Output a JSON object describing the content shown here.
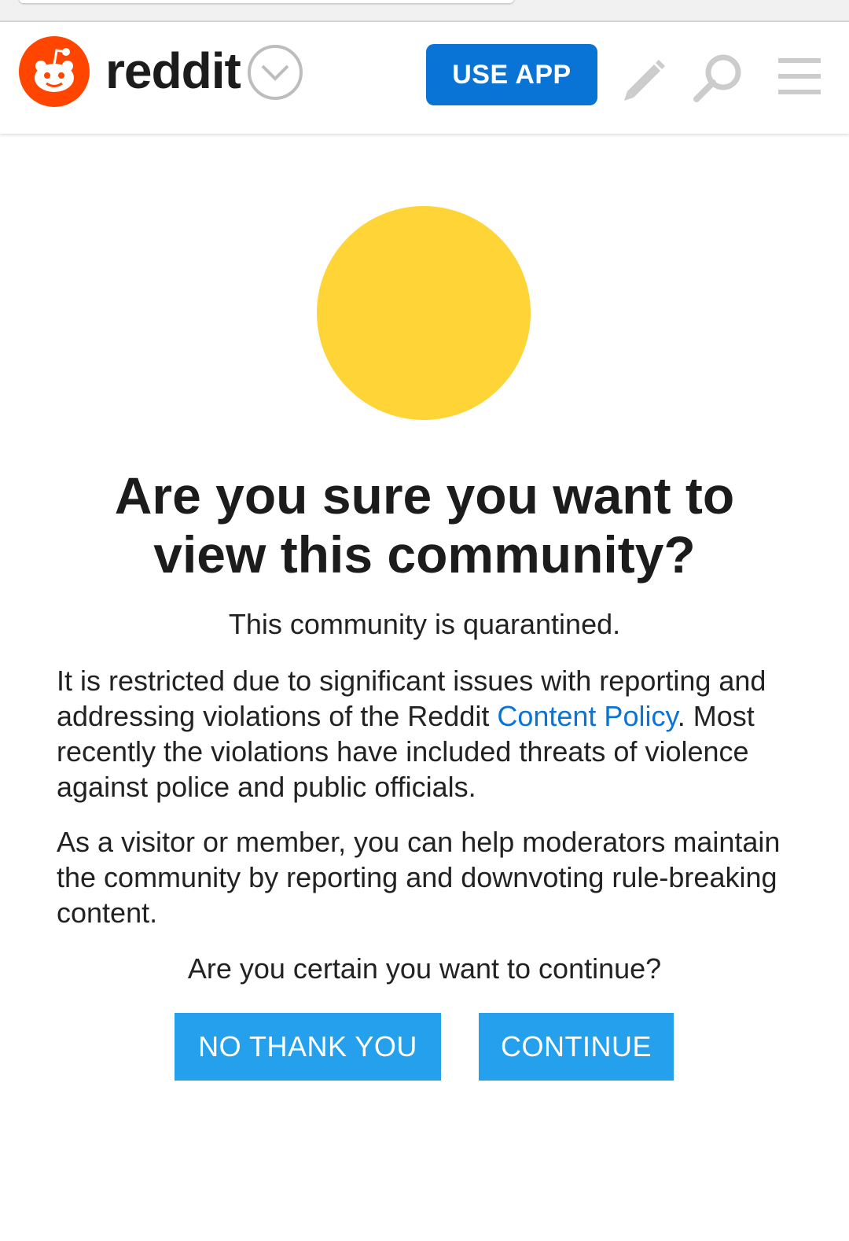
{
  "header": {
    "logo_text": "reddit",
    "use_app_label": "USE APP",
    "icons": [
      "reddit-logo-icon",
      "chevron-down-icon",
      "pencil-icon",
      "search-icon",
      "menu-icon"
    ]
  },
  "community": {
    "avatar_color": "#fed436"
  },
  "quarantine": {
    "title_line1": "Are you sure you want to",
    "title_line2": "view this community?",
    "subtitle": "This community is quarantined.",
    "para1_before": "It is restricted due to significant issues with reporting and addressing violations of the Reddit ",
    "para1_link": "Content Policy",
    "para1_after": ". Most recently the violations have included threats of violence against police and public officials.",
    "para2": "As a visitor or member, you can help moderators maintain the community by reporting and downvoting rule-breaking content.",
    "question": "Are you certain you want to continue?",
    "no_button": "NO THANK YOU",
    "continue_button": "CONTINUE"
  },
  "colors": {
    "brand_orange": "#ff4500",
    "primary_blue": "#0a74d6",
    "button_blue": "#24a0ed"
  }
}
